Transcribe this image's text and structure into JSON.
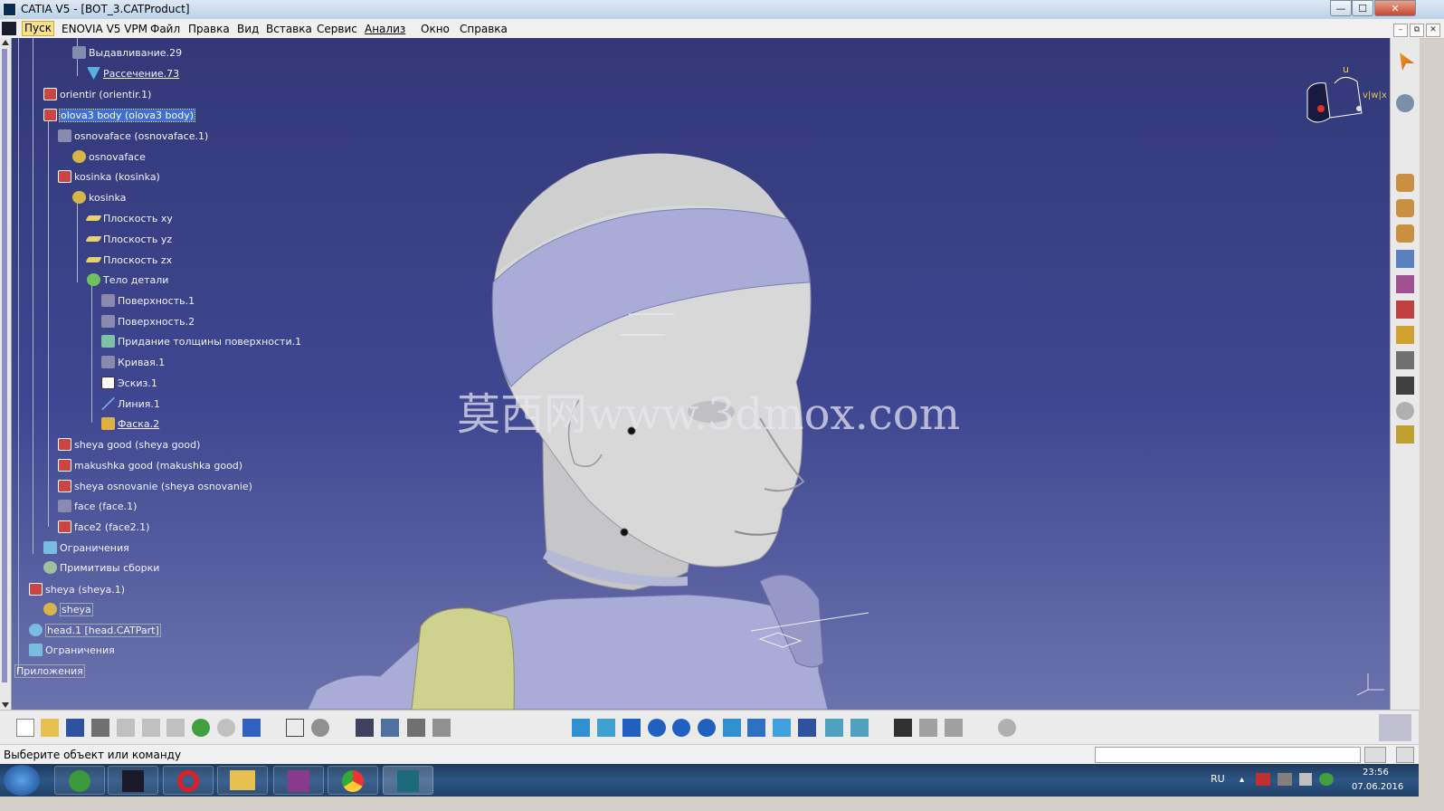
{
  "window": {
    "title": "CATIA V5 - [BOT_3.CATProduct]",
    "min": "—",
    "max": "☐",
    "close": "✕"
  },
  "menu": {
    "items": [
      "Пуск",
      "ENOVIA V5 VPM",
      "Файл",
      "Правка",
      "Вид",
      "Вставка",
      "Сервис",
      "Анализ",
      "Окно",
      "Справка"
    ],
    "doc_controls": [
      "–",
      "⧉",
      "✕"
    ]
  },
  "tree": [
    {
      "label": "Выдавливание.29",
      "icon": "extrude-icon"
    },
    {
      "label": "Рассечение.73",
      "icon": "split-icon",
      "underline": true
    },
    {
      "label": "orientir (orientir.1)",
      "icon": "part-icon"
    },
    {
      "label": "olova3 body (olova3 body)",
      "icon": "part-icon",
      "selected": true
    },
    {
      "label": "osnovaface (osnovaface.1)",
      "icon": "surface-icon"
    },
    {
      "label": "osnovaface",
      "icon": "gear-part-icon"
    },
    {
      "label": "kosinka (kosinka)",
      "icon": "part-icon"
    },
    {
      "label": "kosinka",
      "icon": "gear-part-icon"
    },
    {
      "label": "Плоскость xy",
      "icon": "plane-icon"
    },
    {
      "label": "Плоскость yz",
      "icon": "plane-icon"
    },
    {
      "label": "Плоскость zx",
      "icon": "plane-icon"
    },
    {
      "label": "Тело детали",
      "icon": "body-icon"
    },
    {
      "label": "Поверхность.1",
      "icon": "surface-icon"
    },
    {
      "label": "Поверхность.2",
      "icon": "surface-icon"
    },
    {
      "label": "Придание толщины поверхности.1",
      "icon": "thicken-icon"
    },
    {
      "label": "Кривая.1",
      "icon": "curve-icon"
    },
    {
      "label": "Эскиз.1",
      "icon": "sketch-icon"
    },
    {
      "label": "Линия.1",
      "icon": "line-icon"
    },
    {
      "label": "Фаска.2",
      "icon": "chamfer-icon",
      "underline": true
    },
    {
      "label": "sheya good (sheya good)",
      "icon": "part-icon"
    },
    {
      "label": "makushka good (makushka good)",
      "icon": "part-icon"
    },
    {
      "label": "sheya osnovanie (sheya osnovanie)",
      "icon": "part-icon"
    },
    {
      "label": "face (face.1)",
      "icon": "surface-icon"
    },
    {
      "label": "face2 (face2.1)",
      "icon": "part-icon"
    },
    {
      "label": "Ограничения",
      "icon": "constraints-icon"
    },
    {
      "label": "Примитивы сборки",
      "icon": "assembly-features-icon"
    },
    {
      "label": "sheya (sheya.1)",
      "icon": "part-icon"
    },
    {
      "label": "sheya",
      "icon": "gear-part-icon",
      "boxed": true
    },
    {
      "label": "head.1 [head.CATPart]",
      "icon": "product-icon",
      "boxed": true
    },
    {
      "label": "Ограничения",
      "icon": "constraints-icon"
    },
    {
      "label": "Приложения",
      "icon": "applications-icon",
      "boxed": true
    }
  ],
  "viewport": {
    "watermark": "莫西网www.3dmox.com",
    "compass_u": "u",
    "compass_vw": "v|w|x"
  },
  "statusbar": {
    "prompt": "Выберите объект или команду",
    "command_input": ""
  },
  "taskbar": {
    "lang": "RU",
    "time": "23:56",
    "date": "07.06.2016"
  },
  "colors": {
    "viewport_top": "#323877",
    "viewport_bottom": "#6b73ad",
    "body": "#a9acd6",
    "skin": "#d8d8d8",
    "selection": "#3e6ed8",
    "arm": "#cfd18e"
  }
}
